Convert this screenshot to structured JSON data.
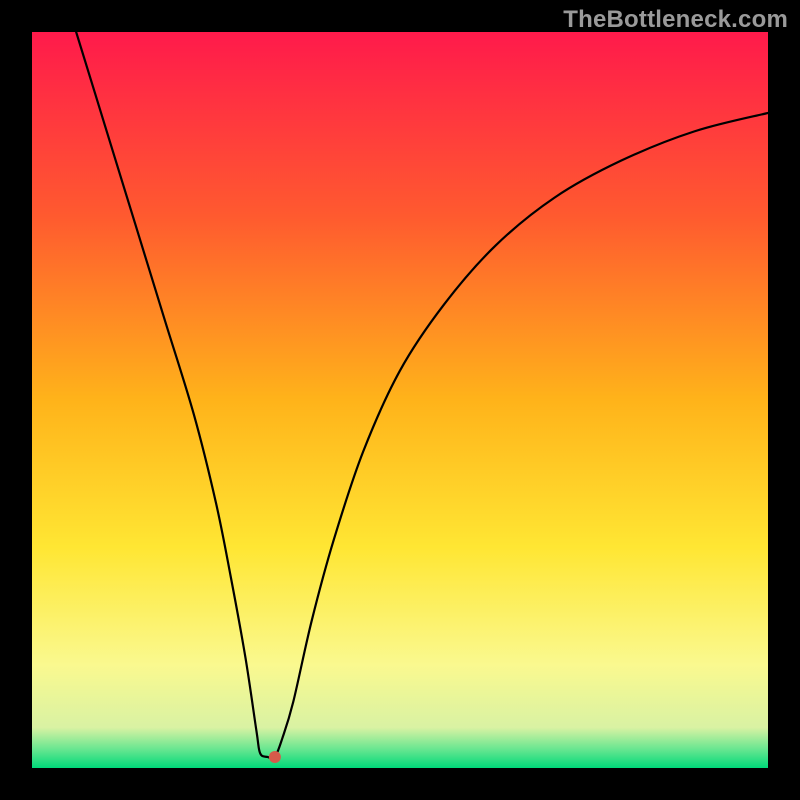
{
  "watermark": "TheBottleneck.com",
  "chart_data": {
    "type": "line",
    "title": "",
    "xlabel": "",
    "ylabel": "",
    "xlim": [
      0,
      100
    ],
    "ylim": [
      0,
      100
    ],
    "grid": false,
    "legend": false,
    "background_gradient": [
      {
        "offset": 0.0,
        "color": "#ff1a4b"
      },
      {
        "offset": 0.25,
        "color": "#ff5a2f"
      },
      {
        "offset": 0.5,
        "color": "#ffb31a"
      },
      {
        "offset": 0.7,
        "color": "#ffe633"
      },
      {
        "offset": 0.86,
        "color": "#faf98f"
      },
      {
        "offset": 0.945,
        "color": "#d9f2a3"
      },
      {
        "offset": 0.975,
        "color": "#66e690"
      },
      {
        "offset": 1.0,
        "color": "#00d979"
      }
    ],
    "series": [
      {
        "name": "bottleneck-curve",
        "color": "#000000",
        "x": [
          6,
          10,
          14,
          18,
          22,
          25,
          27,
          29,
          30.5,
          31,
          32,
          33,
          34,
          35.5,
          38,
          41,
          45,
          50,
          56,
          63,
          71,
          80,
          90,
          100
        ],
        "y": [
          100,
          87,
          74,
          61,
          48,
          36,
          26,
          15,
          5,
          2,
          1.5,
          1.5,
          4,
          9,
          20,
          31,
          43,
          54,
          63,
          71,
          77.5,
          82.5,
          86.5,
          89
        ]
      }
    ],
    "marker": {
      "x": 33,
      "y": 1.5,
      "color": "#d65a4a",
      "radius_px": 6
    }
  }
}
